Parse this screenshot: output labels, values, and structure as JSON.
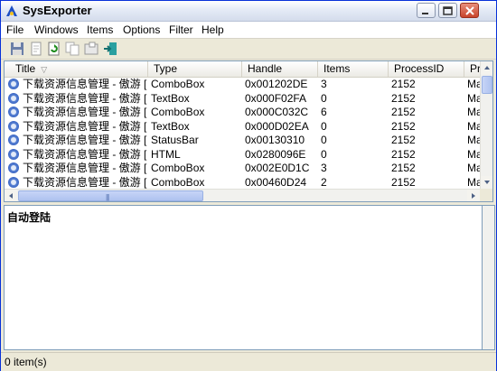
{
  "window": {
    "title": "SysExporter"
  },
  "menu": [
    "File",
    "Windows",
    "Items",
    "Options",
    "Filter",
    "Help"
  ],
  "toolbar": {
    "icons": [
      "save-icon",
      "copy-icon",
      "refresh-icon",
      "copy-items-icon",
      "properties-icon",
      "exit-icon"
    ]
  },
  "list": {
    "columns": [
      "Title",
      "Type",
      "Handle",
      "Items",
      "ProcessID",
      "Pr"
    ],
    "rows": [
      [
        "下载资源信息管理 - 傲游 [...",
        "ComboBox",
        "0x001202DE",
        "3",
        "2152",
        "Ma"
      ],
      [
        "下载资源信息管理 - 傲游 [...",
        "TextBox",
        "0x000F02FA",
        "0",
        "2152",
        "Ma"
      ],
      [
        "下载资源信息管理 - 傲游 [...",
        "ComboBox",
        "0x000C032C",
        "6",
        "2152",
        "Ma"
      ],
      [
        "下载资源信息管理 - 傲游 [...",
        "TextBox",
        "0x000D02EA",
        "0",
        "2152",
        "Ma"
      ],
      [
        "下载资源信息管理 - 傲游 [...",
        "StatusBar",
        "0x00130310",
        "0",
        "2152",
        "Ma"
      ],
      [
        "下载资源信息管理 - 傲游 [...",
        "HTML",
        "0x0280096E",
        "0",
        "2152",
        "Ma"
      ],
      [
        "下载资源信息管理 - 傲游 [...",
        "ComboBox",
        "0x002E0D1C",
        "3",
        "2152",
        "Ma"
      ],
      [
        "下载资源信息管理 - 傲游 [...",
        "ComboBox",
        "0x00460D24",
        "2",
        "2152",
        "Ma"
      ]
    ],
    "sort_icon": "sort-indicator-icon"
  },
  "detail": {
    "text": "自动登陆"
  },
  "status": {
    "text": "0 item(s)"
  },
  "colors": {
    "titlebar_accent": "#0831d9",
    "close_button": "#c8442b",
    "scroll_thumb": "#aec2ef"
  }
}
